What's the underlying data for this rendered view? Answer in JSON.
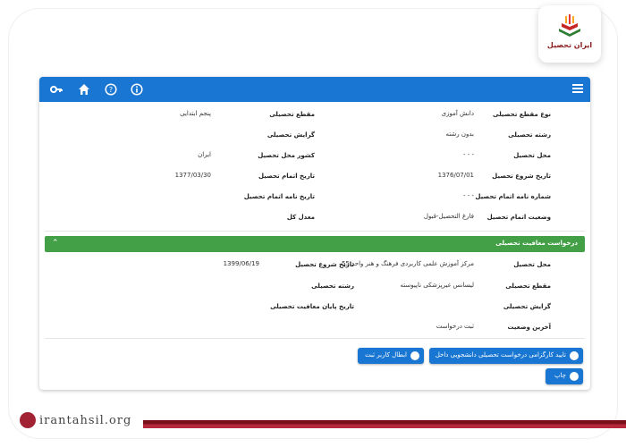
{
  "logo": {
    "text": "ایران تحصیل"
  },
  "footer": {
    "url": "irantahsil.org"
  },
  "colors": {
    "primary": "#1976d2",
    "section": "#43a047",
    "brand": "#8b1a1a"
  },
  "topbar": {
    "icons": [
      "info-icon",
      "help-icon",
      "home-icon",
      "key-icon",
      "menu-icon"
    ]
  },
  "education": {
    "right": [
      {
        "label": "نوع مقطع تحصیلی",
        "value": "دانش آموزی"
      },
      {
        "label": "رشته تحصیلی",
        "value": "بدون رشته"
      },
      {
        "label": "محل تحصیل",
        "value": "- - -"
      },
      {
        "label": "تاریخ شروع تحصیل",
        "value": "1376/07/01"
      },
      {
        "label": "شماره نامه اتمام تحصیل",
        "value": "- - -"
      },
      {
        "label": "وضعیت اتمام تحصیل",
        "value": "فارغ التحصیل-قبول"
      }
    ],
    "left": [
      {
        "label": "مقطع تحصیلی",
        "value": "پنجم ابتدایی"
      },
      {
        "label": "گرایش تحصیلی",
        "value": ""
      },
      {
        "label": "کشور محل تحصیل",
        "value": "ایران"
      },
      {
        "label": "تاریخ اتمام تحصیل",
        "value": "1377/03/30"
      },
      {
        "label": "تاریخ نامه اتمام تحصیل",
        "value": ""
      },
      {
        "label": "معدل کل",
        "value": ""
      }
    ]
  },
  "exemption": {
    "title": "درخواست معافیت تحصیلی",
    "right": [
      {
        "label": "محل تحصیل",
        "value": "مرکز آموزش علمی کاربردی فرهنگ و هنر واحد 55"
      },
      {
        "label": "مقطع تحصیلی",
        "value": "لیسانس غیرپزشکی ناپیوسته"
      },
      {
        "label": "گرایش تحصیلی",
        "value": ""
      },
      {
        "label": "آخرین وضعیت",
        "value": "ثبت درخواست"
      }
    ],
    "left": [
      {
        "label": "تاریخ شروع تحصیل",
        "value": "1399/06/19"
      },
      {
        "label": "رشته تحصیلی",
        "value": ""
      },
      {
        "label": "تاریخ پایان معافیت تحصیلی",
        "value": ""
      }
    ]
  },
  "buttons": {
    "confirm": "تایید کارگزامی درخواست تحصیلی دانشجویی داخل",
    "cancel": "ابطال کاربر ثبت",
    "print": "چاپ"
  }
}
